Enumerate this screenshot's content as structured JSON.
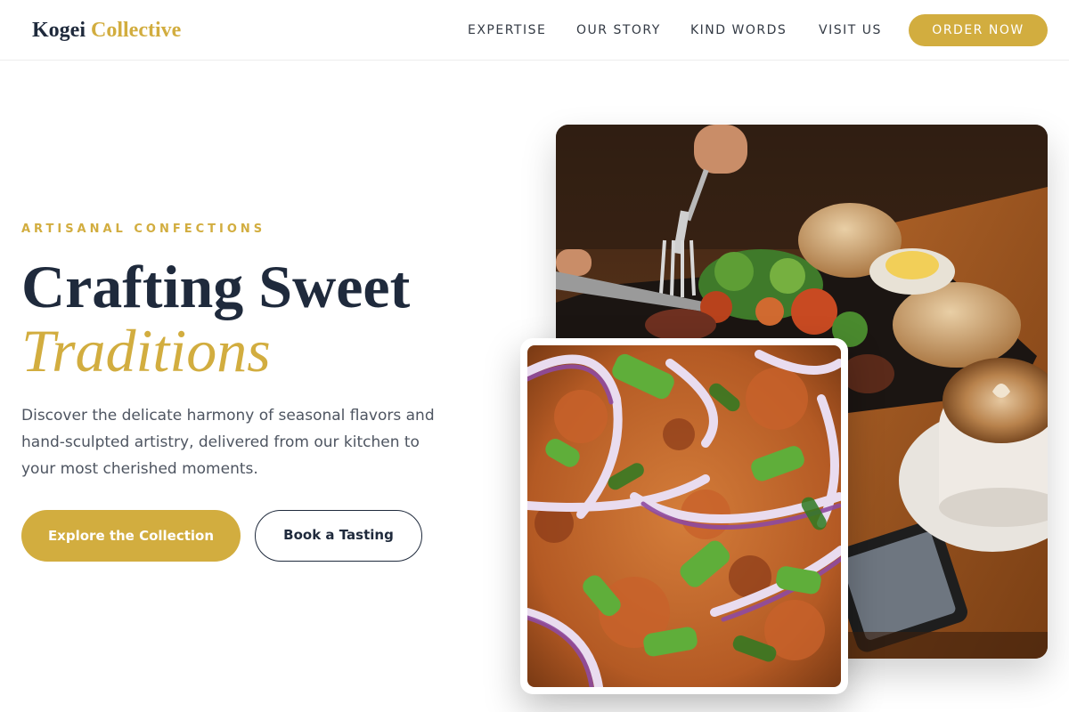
{
  "brand": {
    "word1": "Kogei",
    "word2": "Collective"
  },
  "nav": {
    "items": [
      "EXPERTISE",
      "OUR STORY",
      "KIND WORDS",
      "VISIT US"
    ],
    "cta": "ORDER NOW"
  },
  "hero": {
    "eyebrow": "ARTISANAL CONFECTIONS",
    "title_line1": "Crafting Sweet",
    "title_line2": "Traditions",
    "description": "Discover the delicate harmony of seasonal flavors and hand-sculpted artistry, delivered from our kitchen to your most cherished moments.",
    "primary_button": "Explore the Collection",
    "secondary_button": "Book a Tasting"
  },
  "images": {
    "main_photo_icon": "table-meal-photo",
    "card_photo_icon": "food-closeup-photo"
  },
  "colors": {
    "accent": "#d2ad3f",
    "heading": "#1f2a3c",
    "body_text": "#4e5561"
  }
}
